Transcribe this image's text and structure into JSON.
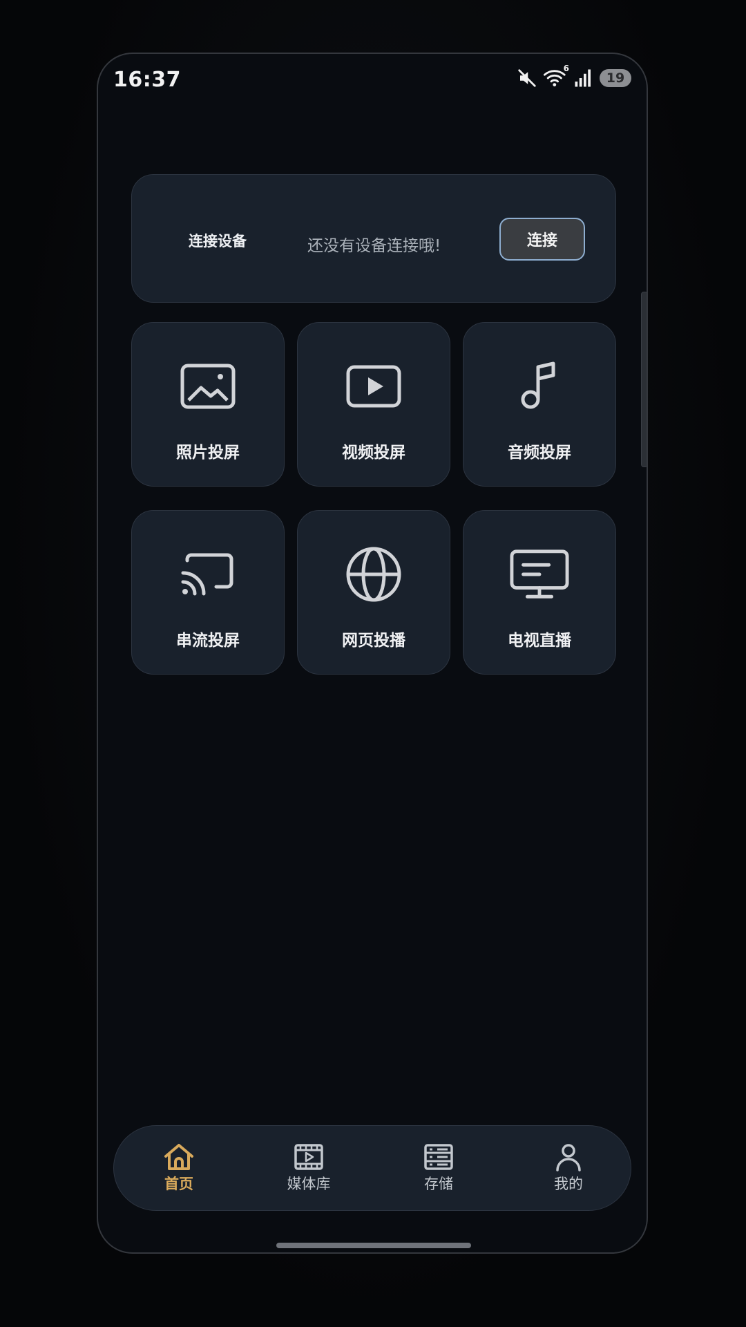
{
  "status_bar": {
    "time": "16:37",
    "battery": "19",
    "network_badge": "6",
    "icons": [
      "mute-icon",
      "wifi-icon",
      "signal-icon",
      "battery-icon"
    ]
  },
  "connect_card": {
    "title": "连接设备",
    "status": "还没有设备连接哦!",
    "button": "连接"
  },
  "tiles": [
    {
      "label": "照片投屏",
      "icon": "image-icon"
    },
    {
      "label": "视频投屏",
      "icon": "video-play-icon"
    },
    {
      "label": "音频投屏",
      "icon": "music-note-icon"
    },
    {
      "label": "串流投屏",
      "icon": "cast-icon"
    },
    {
      "label": "网页投播",
      "icon": "globe-icon"
    },
    {
      "label": "电视直播",
      "icon": "tv-monitor-icon"
    }
  ],
  "bottom_nav": {
    "items": [
      {
        "label": "首页",
        "icon": "home-icon",
        "active": true
      },
      {
        "label": "媒体库",
        "icon": "media-library-icon",
        "active": false
      },
      {
        "label": "存储",
        "icon": "storage-icon",
        "active": false
      },
      {
        "label": "我的",
        "icon": "profile-icon",
        "active": false
      }
    ]
  },
  "colors": {
    "accent": "#d9aa5c",
    "card": "#19212c",
    "background": "#090c11",
    "button_border": "#8eaed0"
  }
}
